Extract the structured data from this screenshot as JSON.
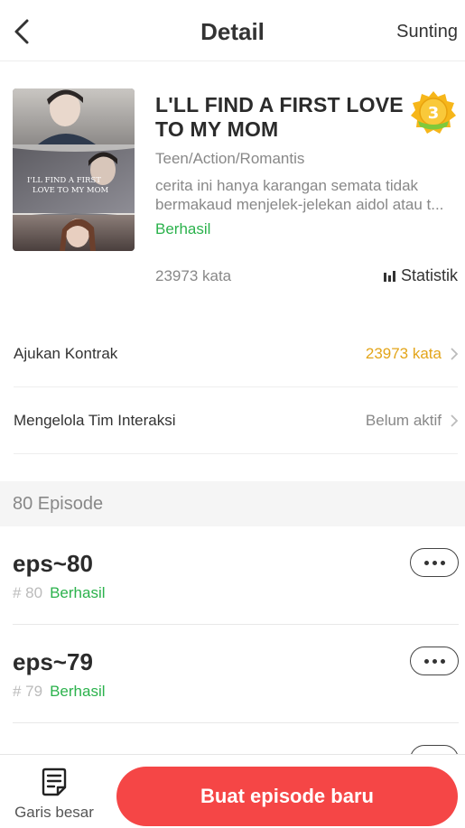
{
  "header": {
    "title": "Detail",
    "edit_label": "Sunting",
    "back_icon": "chevron-left-icon"
  },
  "book": {
    "title": "L'LL FIND A FIRST LOVE TO MY MOM",
    "genre": "Teen/Action/Romantis",
    "description_line1": "cerita ini hanya karangan semata tidak",
    "description_line2": "bermakaud menjelek-jelekan aidol atau t...",
    "status": "Berhasil",
    "word_count": "23973 kata",
    "stats_label": "Statistik",
    "level": "3",
    "cover_text_line1": "I'LL FIND A FIRST",
    "cover_text_line2": "LOVE TO MY MOM"
  },
  "rows": [
    {
      "label": "Ajukan Kontrak",
      "value": "23973 kata"
    },
    {
      "label": "Mengelola Tim Interaksi",
      "value": "Belum aktif"
    }
  ],
  "episodes": {
    "header": "80 Episode",
    "items": [
      {
        "title": "eps~80",
        "number": "# 80",
        "status": "Berhasil"
      },
      {
        "title": "eps~79",
        "number": "# 79",
        "status": "Berhasil"
      }
    ]
  },
  "bottom": {
    "outline_label": "Garis besar",
    "new_episode_label": "Buat episode baru"
  },
  "colors": {
    "accent_red": "#f54646",
    "success_green": "#2bb24c",
    "highlight_orange": "#e3a51a"
  }
}
